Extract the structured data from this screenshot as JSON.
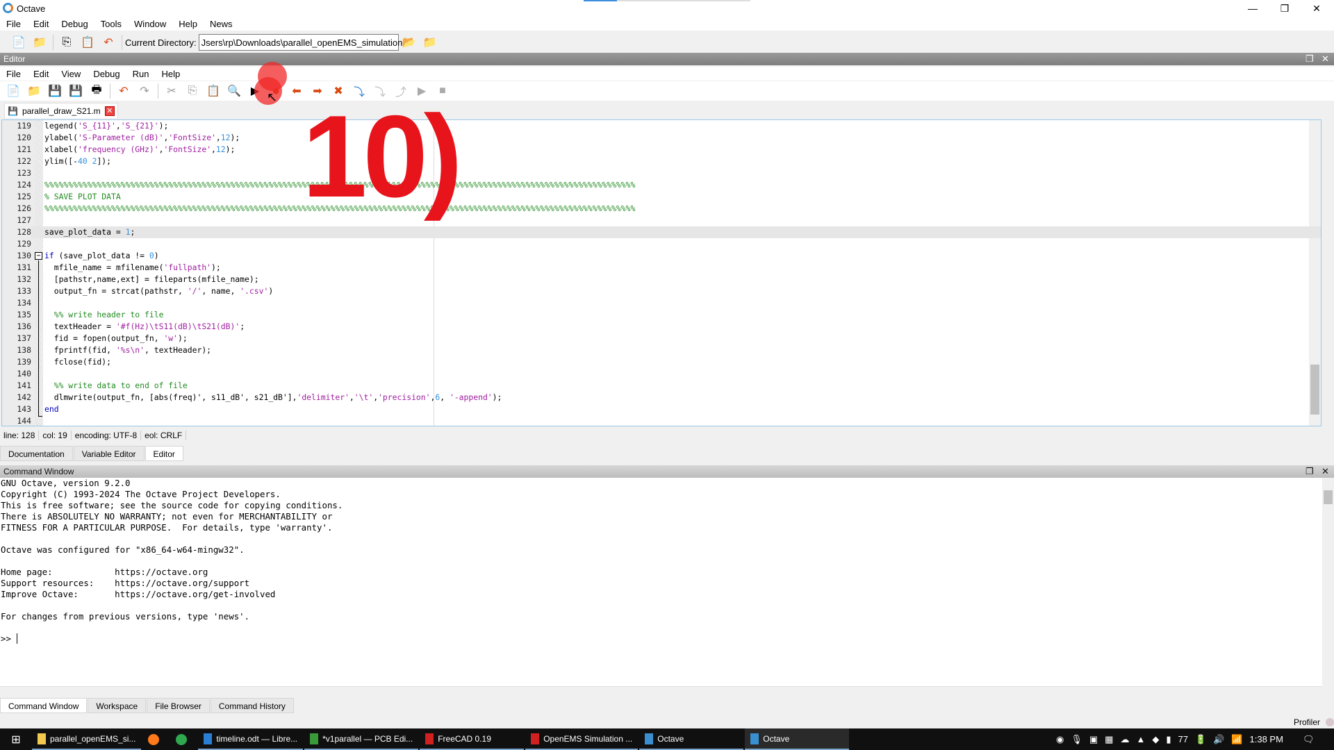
{
  "window": {
    "title": "Octave",
    "minimize": "—",
    "restore": "❐",
    "close": "✕"
  },
  "menu": [
    "File",
    "Edit",
    "Debug",
    "Tools",
    "Window",
    "Help",
    "News"
  ],
  "toolbar": {
    "dir_label": "Current Directory:",
    "dir_value": "Jsers\\rp\\Downloads\\parallel_openEMS_simulation"
  },
  "editor": {
    "header": "Editor",
    "menu": [
      "File",
      "Edit",
      "View",
      "Debug",
      "Run",
      "Help"
    ],
    "tab": "parallel_draw_S21.m",
    "current_line": "128",
    "lines": [
      [
        "119",
        [
          [
            "legend(",
            ""
          ],
          [
            "'S_{11}'",
            "str"
          ],
          [
            ",",
            ""
          ],
          [
            "'S_{21}'",
            "str"
          ],
          [
            ");",
            ""
          ]
        ]
      ],
      [
        "120",
        [
          [
            "ylabel(",
            ""
          ],
          [
            "'S-Parameter (dB)'",
            "str"
          ],
          [
            ",",
            ""
          ],
          [
            "'FontSize'",
            "str"
          ],
          [
            ",",
            ""
          ],
          [
            "12",
            "num"
          ],
          [
            ");",
            ""
          ]
        ]
      ],
      [
        "121",
        [
          [
            "xlabel(",
            ""
          ],
          [
            "'frequency (GHz)'",
            "str"
          ],
          [
            ",",
            ""
          ],
          [
            "'FontSize'",
            "str"
          ],
          [
            ",",
            ""
          ],
          [
            "12",
            "num"
          ],
          [
            ");",
            ""
          ]
        ]
      ],
      [
        "122",
        [
          [
            "ylim([-",
            ""
          ],
          [
            "40",
            "num"
          ],
          [
            " ",
            ""
          ],
          [
            "2",
            "num"
          ],
          [
            "]);",
            ""
          ]
        ]
      ],
      [
        "123",
        []
      ],
      [
        "124",
        [
          [
            "%%%%%%%%%%%%%%%%%%%%%%%%%%%%%%%%%%%%%%%%%%%%%%%%%%%%%%%%%%%%%%%%%%%%%%%%%%%%%%%%%%%%%%%%%%%%%%%%%%%%%%%%%%%%%%%%%%%%%%%%%%%%",
            "com"
          ]
        ]
      ],
      [
        "125",
        [
          [
            "% SAVE PLOT DATA",
            "com"
          ]
        ]
      ],
      [
        "126",
        [
          [
            "%%%%%%%%%%%%%%%%%%%%%%%%%%%%%%%%%%%%%%%%%%%%%%%%%%%%%%%%%%%%%%%%%%%%%%%%%%%%%%%%%%%%%%%%%%%%%%%%%%%%%%%%%%%%%%%%%%%%%%%%%%%%",
            "com"
          ]
        ]
      ],
      [
        "127",
        []
      ],
      [
        "128",
        [
          [
            "save_plot_data = ",
            ""
          ],
          [
            "1",
            "num"
          ],
          [
            ";",
            ""
          ]
        ]
      ],
      [
        "129",
        []
      ],
      [
        "130",
        [
          [
            "if",
            "kw"
          ],
          [
            " (save_plot_data != ",
            ""
          ],
          [
            "0",
            "num"
          ],
          [
            ")",
            ""
          ]
        ]
      ],
      [
        "131",
        [
          [
            "  mfile_name = mfilename(",
            ""
          ],
          [
            "'fullpath'",
            "str"
          ],
          [
            ");",
            ""
          ]
        ]
      ],
      [
        "132",
        [
          [
            "  [pathstr,name,ext] = fileparts(mfile_name);",
            ""
          ]
        ]
      ],
      [
        "133",
        [
          [
            "  output_fn = strcat(pathstr, ",
            ""
          ],
          [
            "'/'",
            "str"
          ],
          [
            ", name, ",
            ""
          ],
          [
            "'.csv'",
            "str"
          ],
          [
            ")",
            ""
          ]
        ]
      ],
      [
        "134",
        []
      ],
      [
        "135",
        [
          [
            "  %% write header to file",
            "com"
          ]
        ]
      ],
      [
        "136",
        [
          [
            "  textHeader = ",
            ""
          ],
          [
            "'#f(Hz)\\tS11(dB)\\tS21(dB)'",
            "str"
          ],
          [
            ";",
            ""
          ]
        ]
      ],
      [
        "137",
        [
          [
            "  fid = fopen(output_fn, ",
            ""
          ],
          [
            "'w'",
            "str"
          ],
          [
            ");",
            ""
          ]
        ]
      ],
      [
        "138",
        [
          [
            "  fprintf(fid, ",
            ""
          ],
          [
            "'%s\\n'",
            "str"
          ],
          [
            ", textHeader);",
            ""
          ]
        ]
      ],
      [
        "139",
        [
          [
            "  fclose(fid);",
            ""
          ]
        ]
      ],
      [
        "140",
        []
      ],
      [
        "141",
        [
          [
            "  %% write data to end of file",
            "com"
          ]
        ]
      ],
      [
        "142",
        [
          [
            "  dlmwrite(output_fn, [abs(freq)', s11_dB', s21_dB'],",
            ""
          ],
          [
            "'delimiter'",
            "str"
          ],
          [
            ",",
            ""
          ],
          [
            "'\\t'",
            "str"
          ],
          [
            ",",
            ""
          ],
          [
            "'precision'",
            "str"
          ],
          [
            ",",
            ""
          ],
          [
            "6",
            "num"
          ],
          [
            ", ",
            ""
          ],
          [
            "'-append'",
            "str"
          ],
          [
            ");",
            ""
          ]
        ]
      ],
      [
        "143",
        [
          [
            "end",
            "kw"
          ]
        ]
      ],
      [
        "144",
        []
      ]
    ],
    "status": {
      "line_label": "line:",
      "line": "128",
      "col_label": "col:",
      "col": "19",
      "enc_label": "encoding:",
      "enc": "UTF-8",
      "eol_label": "eol:",
      "eol": "CRLF"
    }
  },
  "dock_tabs": [
    "Documentation",
    "Variable Editor",
    "Editor"
  ],
  "command": {
    "header": "Command Window",
    "lines": [
      "GNU Octave, version 9.2.0",
      "Copyright (C) 1993-2024 The Octave Project Developers.",
      "This is free software; see the source code for copying conditions.",
      "There is ABSOLUTELY NO WARRANTY; not even for MERCHANTABILITY or",
      "FITNESS FOR A PARTICULAR PURPOSE.  For details, type 'warranty'.",
      "",
      "Octave was configured for \"x86_64-w64-mingw32\".",
      "",
      "Home page:            https://octave.org",
      "Support resources:    https://octave.org/support",
      "Improve Octave:       https://octave.org/get-involved",
      "",
      "For changes from previous versions, type 'news'.",
      "",
      ">> "
    ]
  },
  "bottom_tabs": [
    "Command Window",
    "Workspace",
    "File Browser",
    "Command History"
  ],
  "profiler": "Profiler",
  "overlay_text": "10)",
  "taskbar": {
    "items": [
      {
        "label": "parallel_openEMS_si...",
        "color": "#f2c94c"
      },
      {
        "label": "",
        "color": "#ff7a1a"
      },
      {
        "label": "",
        "color": "#2fa84f"
      },
      {
        "label": "timeline.odt — Libre...",
        "color": "#2a7fd4"
      },
      {
        "label": "*v1parallel — PCB Edi...",
        "color": "#3a9a3a"
      },
      {
        "label": "FreeCAD 0.19",
        "color": "#d02020"
      },
      {
        "label": "OpenEMS Simulation ...",
        "color": "#d02020"
      },
      {
        "label": "Octave",
        "color": "#3a8fd0"
      },
      {
        "label": "Octave",
        "color": "#3a8fd0"
      }
    ],
    "tray_number": "77",
    "clock": "1:38 PM"
  },
  "colors": {
    "accent": "#3a8fd0",
    "overlay": "#e8141c"
  }
}
